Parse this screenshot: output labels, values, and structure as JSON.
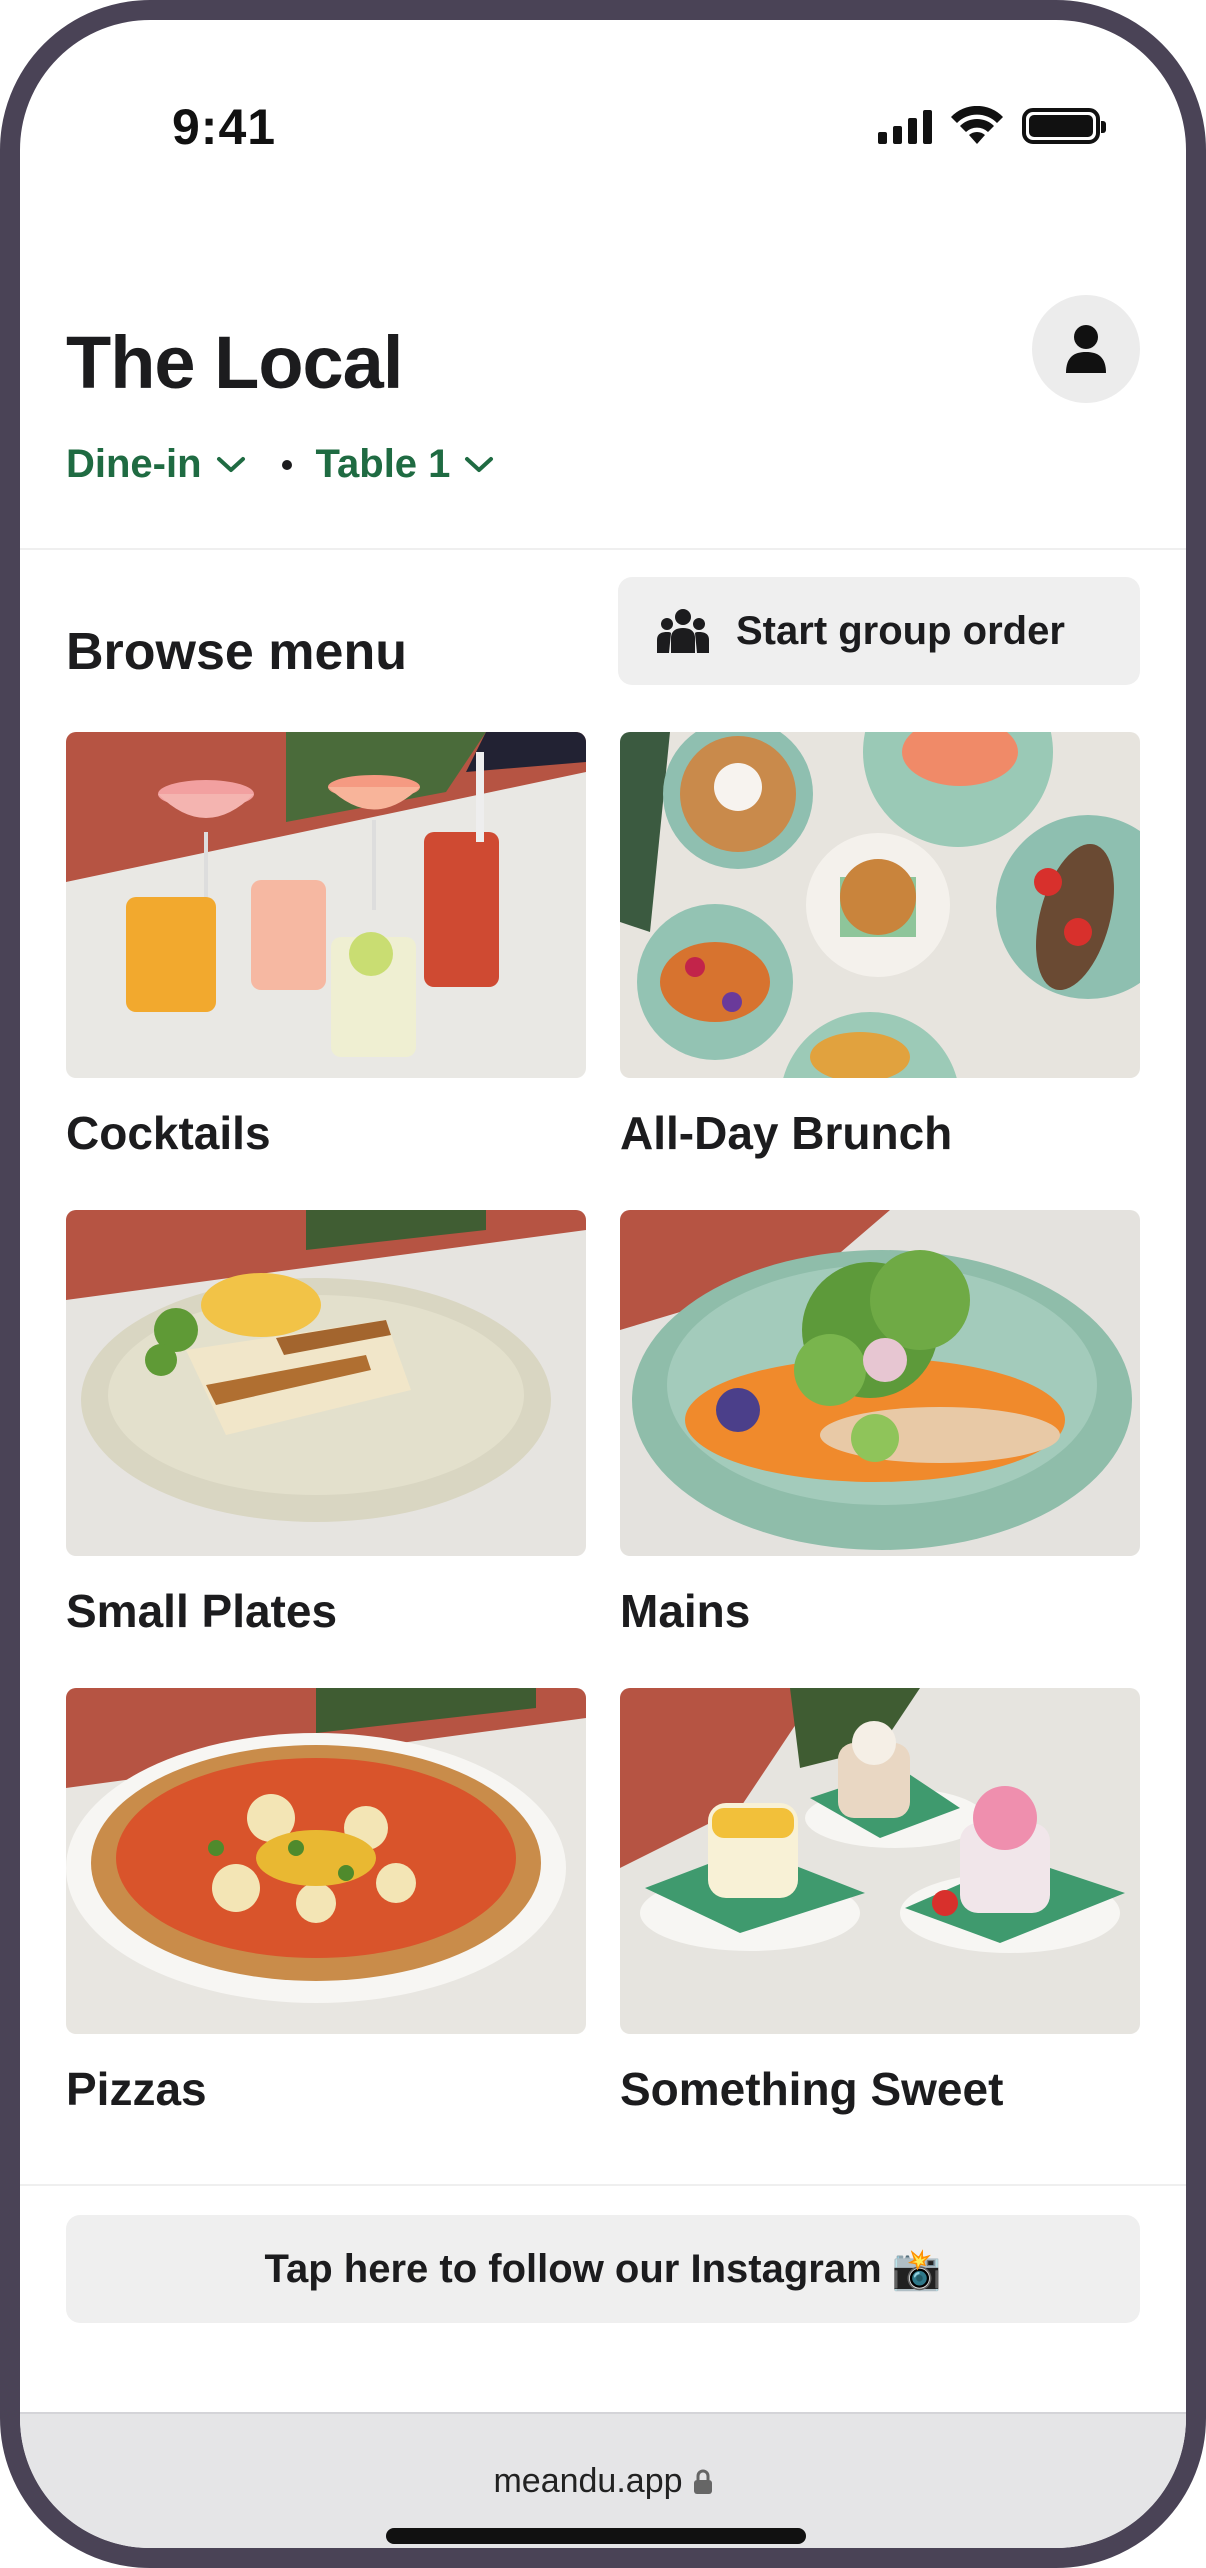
{
  "status_bar": {
    "time": "9:41"
  },
  "header": {
    "venue_name": "The Local",
    "order_mode": "Dine-in",
    "table": "Table 1"
  },
  "browse": {
    "title": "Browse menu",
    "group_order_label": "Start group order"
  },
  "categories": [
    {
      "label": "Cocktails"
    },
    {
      "label": "All-Day Brunch"
    },
    {
      "label": "Small Plates"
    },
    {
      "label": "Mains"
    },
    {
      "label": "Pizzas"
    },
    {
      "label": "Something Sweet"
    }
  ],
  "instagram": {
    "label": "Tap here to follow our Instagram",
    "emoji": "📸"
  },
  "browser": {
    "url": "meandu.app"
  },
  "colors": {
    "accent_green": "#1f6b42",
    "button_grey": "#efefef",
    "frame": "#4a4356"
  }
}
